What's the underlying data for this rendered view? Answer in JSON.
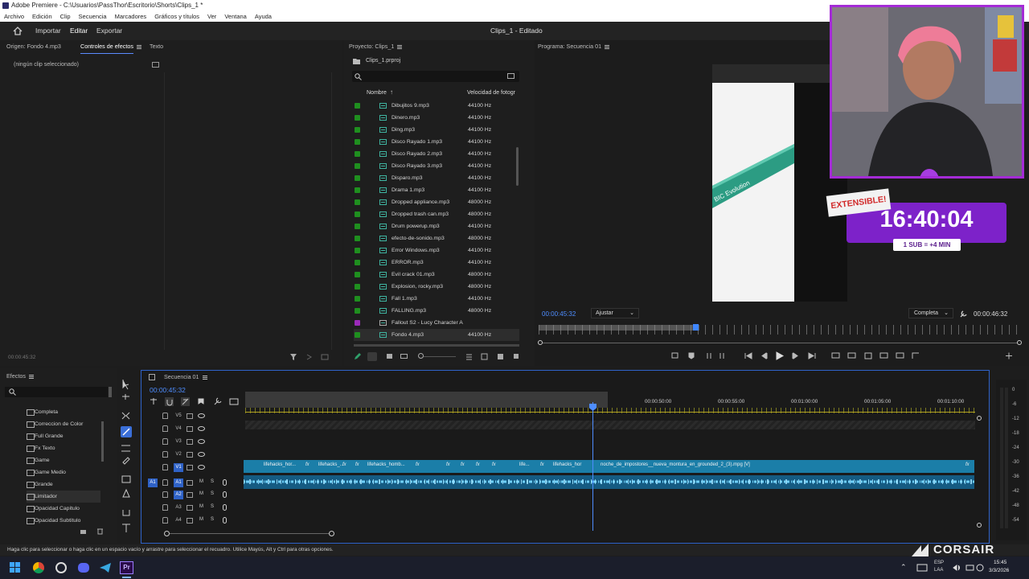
{
  "window": {
    "title": "Adobe Premiere - C:\\Usuarios\\PassThor\\Escritorio\\Shorts\\Clips_1 *",
    "doc_title": "Clips_1 - Editado"
  },
  "menu": [
    "Archivo",
    "Edición",
    "Clip",
    "Secuencia",
    "Marcadores",
    "Gráficos y títulos",
    "Ver",
    "Ventana",
    "Ayuda"
  ],
  "workspace_tabs": {
    "import": "Importar",
    "edit": "Editar",
    "export": "Exportar"
  },
  "source_panel": {
    "tabs": [
      "Origen: Fondo 4.mp3",
      "Controles de efectos",
      "Texto"
    ],
    "empty_label": "(ningún clip seleccionado)",
    "timecode": "00:00:45:32"
  },
  "project_panel": {
    "title": "Proyecto: Clips_1",
    "file": "Clips_1.prproj",
    "col_name": "Nombre",
    "col_rate": "Velocidad de fotogr",
    "items": [
      {
        "name": "Dibujitos 9.mp3",
        "rate": "44100 Hz"
      },
      {
        "name": "Dinero.mp3",
        "rate": "44100 Hz"
      },
      {
        "name": "Ding.mp3",
        "rate": "44100 Hz"
      },
      {
        "name": "Disco Rayado 1.mp3",
        "rate": "44100 Hz"
      },
      {
        "name": "Disco Rayado 2.mp3",
        "rate": "44100 Hz"
      },
      {
        "name": "Disco Rayado 3.mp3",
        "rate": "44100 Hz"
      },
      {
        "name": "Disparo.mp3",
        "rate": "44100 Hz"
      },
      {
        "name": "Drama 1.mp3",
        "rate": "44100 Hz"
      },
      {
        "name": "Dropped appliance.mp3",
        "rate": "48000 Hz"
      },
      {
        "name": "Dropped trash can.mp3",
        "rate": "48000 Hz"
      },
      {
        "name": "Drum powerup.mp3",
        "rate": "44100 Hz"
      },
      {
        "name": "efecto-de-sonido.mp3",
        "rate": "48000 Hz"
      },
      {
        "name": "Error Windows.mp3",
        "rate": "44100 Hz"
      },
      {
        "name": "ERROR.mp3",
        "rate": "44100 Hz"
      },
      {
        "name": "Evil crack 01.mp3",
        "rate": "48000 Hz"
      },
      {
        "name": "Explosion, rocky.mp3",
        "rate": "48000 Hz"
      },
      {
        "name": "Fall 1.mp3",
        "rate": "44100 Hz"
      },
      {
        "name": "FALLING.mp3",
        "rate": "48000 Hz"
      },
      {
        "name": "Fallout S2 - Lucy Character A",
        "rate": ""
      },
      {
        "name": "Fondo 4.mp3",
        "rate": "44100 Hz"
      }
    ]
  },
  "program_panel": {
    "title": "Programa: Secuencia 01",
    "timecode": "00:00:45:32",
    "fit": "Ajustar",
    "quality": "Completa",
    "duration": "00:00:46:32"
  },
  "overlay": {
    "extensible": "EXTENSIBLE!",
    "timer": "16:40:04",
    "sub_rule": "1 SUB = +4 MIN",
    "brand": "CORSAIR"
  },
  "effects_panel": {
    "title": "Efectos",
    "items": [
      "Completa",
      "Correccion de Color",
      "Full Grande",
      "Fx Texto",
      "Game",
      "Game Medio",
      "Grande",
      "Limitador",
      "Opacidad Capitulo",
      "Opacidad Subtitulo"
    ]
  },
  "timeline": {
    "title": "Secuencia 01",
    "timecode": "00:00:45:32",
    "ruler": [
      "00:00:25:00",
      "00:00:30:00",
      "00:00:35:00",
      "00:00:40:00",
      "00:00:45:00",
      "00:00:50:00",
      "00:00:55:00",
      "00:01:00:00",
      "00:01:05:00",
      "00:01:10:00"
    ],
    "video_tracks": [
      "V5",
      "V4",
      "V3",
      "V2",
      "V1"
    ],
    "audio_tracks": [
      "A1",
      "A2",
      "A3",
      "A4"
    ],
    "clips": [
      "lifehacks_hor...",
      "lifehacks_...",
      "lifehacks_homb...",
      "life...",
      "lifehacks_hor",
      "noche_de_impostores__nueva_montura_en_grounded_2_(3).mpg [V]"
    ],
    "meter_labels": [
      "0",
      "-6",
      "-12",
      "-18",
      "-24",
      "-30",
      "-36",
      "-42",
      "-48",
      "-54"
    ]
  },
  "status_bar": "Haga clic para seleccionar o haga clic en un espacio vacío y arrastre para seleccionar el recuadro. Utilice Mayús, Alt y Ctrl para otras opciones.",
  "taskbar": {
    "lang": "ESP",
    "region": "LAA",
    "time": "15:45",
    "date": "3/3/2026"
  }
}
